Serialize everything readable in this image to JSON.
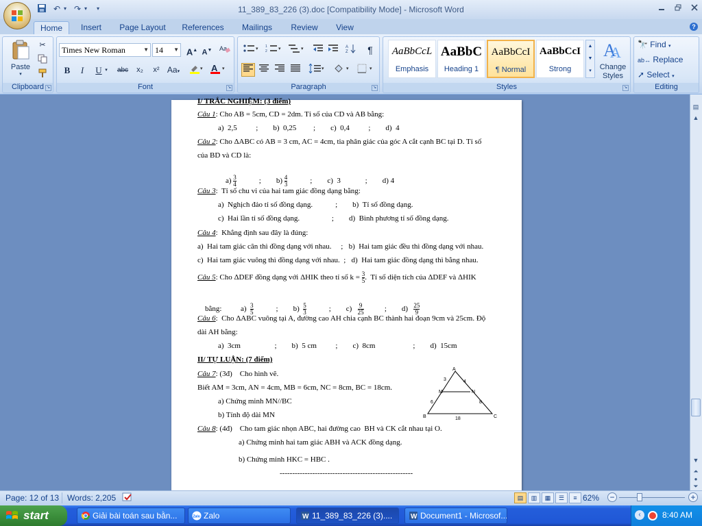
{
  "window": {
    "title": "11_389_83_226 (3).doc [Compatibility Mode] - Microsoft Word",
    "min_icon": "minimize-icon",
    "max_icon": "restore-icon",
    "close_icon": "close-icon"
  },
  "qat": {
    "undo_glyph": "↶",
    "redo_glyph": "↷",
    "more_glyph": "▾"
  },
  "tabs": [
    {
      "label": "Home",
      "active": true
    },
    {
      "label": "Insert"
    },
    {
      "label": "Page Layout"
    },
    {
      "label": "References"
    },
    {
      "label": "Mailings"
    },
    {
      "label": "Review"
    },
    {
      "label": "View"
    }
  ],
  "ribbon": {
    "clipboard": {
      "label": "Clipboard",
      "paste": "Paste"
    },
    "font": {
      "label": "Font",
      "font_name": "Times New Roman",
      "font_size": "14",
      "bold": "B",
      "italic": "I",
      "underline": "U",
      "strike": "abc",
      "subscript": "x₂",
      "superscript": "x²",
      "change_case": "Aa",
      "grow": "A",
      "shrink": "A",
      "highlight_color": "#ffff00",
      "font_color": "#ff0000"
    },
    "paragraph": {
      "label": "Paragraph",
      "pilcrow": "¶"
    },
    "styles": {
      "label": "Styles",
      "items": [
        {
          "sample": "AaBbCcL",
          "name": "Emphasis"
        },
        {
          "sample": "AaBbC",
          "name": "Heading 1"
        },
        {
          "sample": "AaBbCcI",
          "name": "¶ Normal"
        },
        {
          "sample": "AaBbCcI",
          "name": "Strong"
        }
      ],
      "change_styles": [
        "Change",
        "Styles"
      ]
    },
    "editing": {
      "label": "Editing",
      "find": "Find",
      "replace": "Replace",
      "select": "Select"
    }
  },
  "document": {
    "lines": [
      {
        "text": "I/ TRẮC NGHIỆM: (3 điểm)"
      },
      {
        "label": "Câu 1",
        "text": ": Cho AB = 5cm, CD = 2dm. Tỉ số của CD và AB bằng:"
      },
      {
        "text": "a)  2,5          ;        b)  0,25         ;        c)  0,4          ;        d)  4"
      },
      {
        "label": "Câu 2",
        "text": ": Cho ΔABC có AB = 3 cm, AC = 4cm, tia phân giác của góc A cắt cạnh BC tại D. Tỉ số"
      },
      {
        "text": "của BD và CD là:"
      },
      {
        "q2a": "a)",
        "q2b": "b)",
        "q2c": "c)  3",
        "q2d": "d) 4",
        "f1n": "3",
        "f1d": "4",
        "f2n": "4",
        "f2d": "3"
      },
      {
        "label": "Câu 3",
        "text": ":  Tỉ số chu vi của hai tam giác đồng dạng bằng:"
      },
      {
        "text": "a)  Nghịch đảo tỉ số đồng dạng.            ;        b)  Tỉ số đồng dạng."
      },
      {
        "text": "c)  Hai lần tỉ số đồng dạng.                 ;        d)  Bình phương tỉ số đồng dạng."
      },
      {
        "label": "Câu 4",
        "text": ":  Khẳng định sau đây là đúng:"
      },
      {
        "text": "a)  Hai tam giác cân thì đồng dạng với nhau.     ;   b)  Hai tam giác đều thì đồng dạng với nhau."
      },
      {
        "text": "c)  Hai tam giác vuông thì đồng dạng với nhau.  ;   d)  Hai tam giác đồng dạng thì bằng nhau."
      },
      {
        "label": "Câu 5",
        "text": ": Cho ΔDEF đồng dạng với ΔHIK theo tỉ số k = ",
        "tail": ".  Tỉ số diện tích của ΔDEF và ΔHIK",
        "kn": "3",
        "kd": "5"
      },
      {
        "q5": "bằng:",
        "a": "a)",
        "b": "b)",
        "c": "c)",
        "d": "d)",
        "an": "3",
        "ad": "5",
        "bn": "5",
        "bd": "3",
        "cn": "9",
        "cd": "25",
        "dn": "25",
        "dd": "9"
      },
      {
        "label": "Câu 6",
        "text": ":  Cho ΔABC vuông tại A, đường cao AH chia cạnh BC thành hai đoạn 9cm và 25cm. Độ"
      },
      {
        "text": "dài AH bằng:"
      },
      {
        "text": "a)  3cm                  ;        b)  5 cm          ;        c)  8cm                    ;        d)  15cm"
      },
      {
        "text": "II/ TỰ LUẬN: (7 điểm)"
      },
      {
        "label": "Câu 7",
        "text": ": (3đ)    Cho hình vẽ."
      },
      {
        "text": "Biết AM = 3cm, AN = 4cm, MB = 6cm, NC = 8cm, BC = 18cm."
      },
      {
        "text": "a) Chứng minh MN//BC"
      },
      {
        "text": "b) Tính độ dài MN"
      },
      {
        "label": "Câu 8",
        "text": ": (4đ)    Cho tam giác nhọn ABC, hai đường cao  BH và CK cắt nhau tại O."
      },
      {
        "text": "a) Chứng minh hai tam giác ABH và ACK đồng dạng."
      },
      {
        "text": "b) Chứng minh HKC = HBC ."
      },
      {
        "text": "-----------------------------------------------------"
      }
    ],
    "figure": {
      "A": "A",
      "M": "M",
      "N": "N",
      "B": "B",
      "C": "C",
      "am": "3",
      "an": "4",
      "mb": "6",
      "nc": "8",
      "bc": "18"
    }
  },
  "status": {
    "page": "Page: 12 of 13",
    "words": "Words: 2,205",
    "zoom": "62%",
    "zoom_fraction": 0.62
  },
  "taskbar": {
    "start": "start",
    "items": [
      {
        "label": "Giải bài toán sau bằn...",
        "icon": "chrome-icon"
      },
      {
        "label": "Zalo",
        "icon": "zalo-icon"
      },
      {
        "label": "11_389_83_226 (3)....",
        "icon": "word-icon",
        "active": true
      },
      {
        "label": "Document1 - Microsof...",
        "icon": "word-icon"
      }
    ],
    "clock": "8:40 AM"
  }
}
